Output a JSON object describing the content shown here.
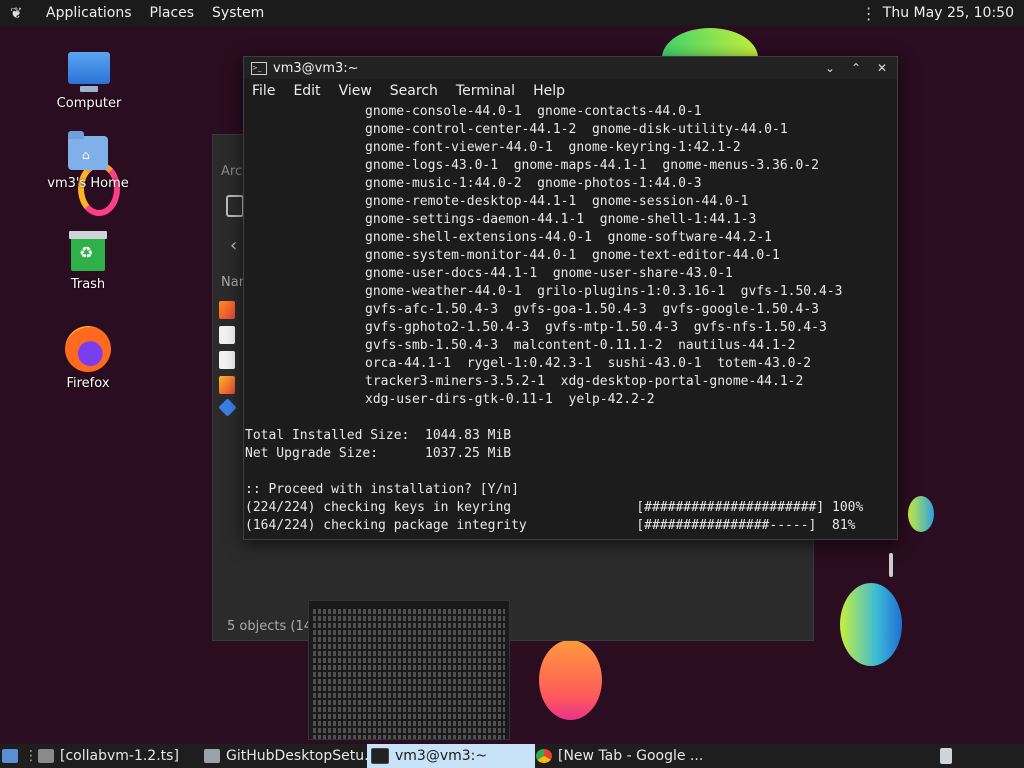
{
  "top_panel": {
    "menus": [
      "Applications",
      "Places",
      "System"
    ],
    "clock": "Thu May 25, 10:50"
  },
  "desktop": {
    "icons": [
      {
        "label": "Computer",
        "icon": "computer-icon"
      },
      {
        "label": "vm3's Home",
        "icon": "home-folder-icon"
      },
      {
        "label": "Trash",
        "icon": "trash-icon"
      },
      {
        "label": "Firefox",
        "icon": "firefox-icon"
      }
    ]
  },
  "file_manager": {
    "title_fragment": "Arch",
    "column_fragment": "Nam",
    "status": "5 objects (141"
  },
  "terminal": {
    "title": "vm3@vm3:~",
    "menu": [
      "File",
      "Edit",
      "View",
      "Search",
      "Terminal",
      "Help"
    ],
    "packages": [
      "gnome-console-44.0-1  gnome-contacts-44.0-1",
      "gnome-control-center-44.1-2  gnome-disk-utility-44.0-1",
      "gnome-font-viewer-44.0-1  gnome-keyring-1:42.1-2",
      "gnome-logs-43.0-1  gnome-maps-44.1-1  gnome-menus-3.36.0-2",
      "gnome-music-1:44.0-2  gnome-photos-1:44.0-3",
      "gnome-remote-desktop-44.1-1  gnome-session-44.0-1",
      "gnome-settings-daemon-44.1-1  gnome-shell-1:44.1-3",
      "gnome-shell-extensions-44.0-1  gnome-software-44.2-1",
      "gnome-system-monitor-44.0-1  gnome-text-editor-44.0-1",
      "gnome-user-docs-44.1-1  gnome-user-share-43.0-1",
      "gnome-weather-44.0-1  grilo-plugins-1:0.3.16-1  gvfs-1.50.4-3",
      "gvfs-afc-1.50.4-3  gvfs-goa-1.50.4-3  gvfs-google-1.50.4-3",
      "gvfs-gphoto2-1.50.4-3  gvfs-mtp-1.50.4-3  gvfs-nfs-1.50.4-3",
      "gvfs-smb-1.50.4-3  malcontent-0.11.1-2  nautilus-44.1-2",
      "orca-44.1-1  rygel-1:0.42.3-1  sushi-43.0-1  totem-43.0-2",
      "tracker3-miners-3.5.2-1  xdg-desktop-portal-gnome-44.1-2",
      "xdg-user-dirs-gtk-0.11-1  yelp-42.2-2"
    ],
    "summary": [
      "Total Installed Size:  1044.83 MiB",
      "Net Upgrade Size:      1037.25 MiB"
    ],
    "prompt": ":: Proceed with installation? [Y/n]",
    "progress": [
      "(224/224) checking keys in keyring                [######################] 100%",
      "(164/224) checking package integrity              [################-----]  81%"
    ]
  },
  "taskbar": {
    "items": [
      {
        "label": "[collabvm-1.2.ts]",
        "icon": "notes-icon"
      },
      {
        "label": "GitHubDesktopSetu...",
        "icon": "installer-icon"
      },
      {
        "label": "vm3@vm3:~",
        "icon": "terminal-icon",
        "active": true
      },
      {
        "label": "[New Tab - Google ...",
        "icon": "chrome-icon"
      }
    ]
  }
}
